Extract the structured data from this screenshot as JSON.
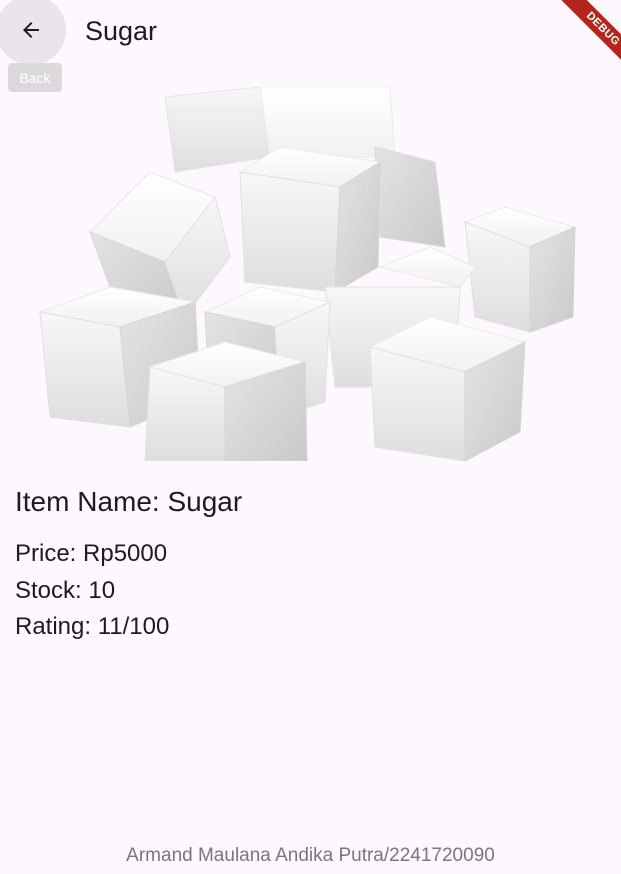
{
  "app_bar": {
    "title": "Sugar",
    "back_icon": "arrow-back-icon",
    "back_tooltip": "Back"
  },
  "debug_banner": {
    "label": "DEBUG",
    "color": "#b3261e"
  },
  "product": {
    "image_subject": "sugar cubes",
    "item_name": "Item Name: Sugar",
    "price": "Price: Rp5000",
    "stock": "Stock: 10",
    "rating": "Rating: 11/100"
  },
  "footer": {
    "text": "Armand Maulana Andika Putra/2241720090"
  },
  "colors": {
    "background": "#fdf7fe",
    "text": "#1d1b20",
    "muted_text": "#7a767d"
  }
}
